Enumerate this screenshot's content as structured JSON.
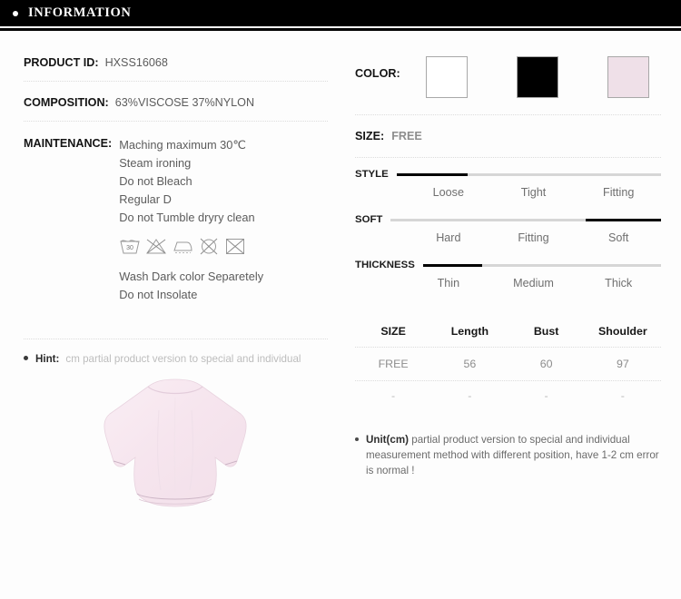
{
  "header": {
    "title": "INFORMATION",
    "bullet_icon": "bullet-dot-icon",
    "bar_color": "#000000",
    "text_color": "#ffffff"
  },
  "left": {
    "product_id": {
      "label": "PRODUCT ID:",
      "value": "HXSS16068"
    },
    "composition": {
      "label": "COMPOSITION:",
      "value": "63%VISCOSE  37%NYLON"
    },
    "maintenance": {
      "label": "MAINTENANCE:",
      "lines": [
        "Maching maximum 30℃",
        "Steam ironing",
        "Do not Bleach",
        "Regular D",
        "Do not Tumble dryry clean"
      ],
      "extra_lines": [
        "Wash Dark color Separetely",
        "Do not Insolate"
      ],
      "care_symbols": [
        {
          "name": "wash-30-icon",
          "title": "Machine wash 30"
        },
        {
          "name": "do-not-bleach-icon",
          "title": "Do not bleach"
        },
        {
          "name": "iron-icon",
          "title": "Iron"
        },
        {
          "name": "do-not-tumble-dry-icon",
          "title": "Do not tumble dry"
        },
        {
          "name": "do-not-dry-clean-icon",
          "title": "Do not dry clean"
        }
      ]
    },
    "hint": {
      "bullet_icon": "bullet-dot-icon",
      "label": "Hint:",
      "text": "cm partial product version to special and individual"
    },
    "garment": {
      "name": "product-photo",
      "alt": "pale pink batwing sleeve top",
      "color": "#f7e6ee"
    }
  },
  "right": {
    "color": {
      "label": "COLOR:",
      "swatches": [
        {
          "name": "swatch-white",
          "hex": "#ffffff"
        },
        {
          "name": "swatch-black",
          "hex": "#000000"
        },
        {
          "name": "swatch-pink",
          "hex": "#efe0e8"
        }
      ]
    },
    "size": {
      "label": "SIZE:",
      "value": "FREE"
    },
    "sliders": [
      {
        "name": "STYLE",
        "options": [
          "Loose",
          "Tight",
          "Fitting"
        ],
        "selected_index": 0,
        "fill_percent": 27
      },
      {
        "name": "SOFT",
        "options": [
          "Hard",
          "Fitting",
          "Soft"
        ],
        "selected_index": 2,
        "fill_percent": 28,
        "fill_from_right": true
      },
      {
        "name": "THICKNESS",
        "options": [
          "Thin",
          "Medium",
          "Thick"
        ],
        "selected_index": 0,
        "fill_percent": 25
      }
    ],
    "size_table": {
      "headers": [
        "SIZE",
        "Length",
        "Bust",
        "Shoulder"
      ],
      "rows": [
        [
          "FREE",
          "56",
          "60",
          "97"
        ],
        [
          "-",
          "-",
          "-",
          "-"
        ]
      ]
    },
    "unit_note": {
      "bullet_icon": "bullet-dot-icon",
      "strong": "Unit(cm)",
      "text": "partial product version to special and individual measurement method with different position, have 1-2 cm error is normal !"
    }
  }
}
